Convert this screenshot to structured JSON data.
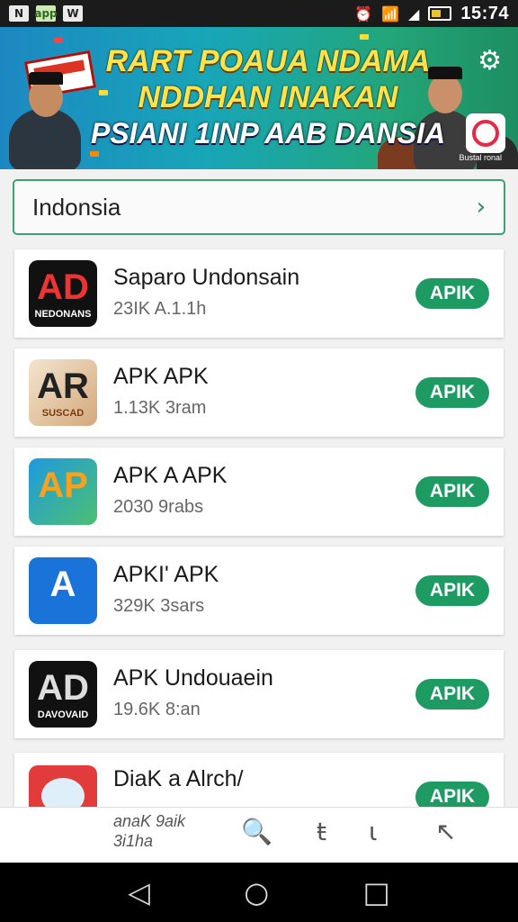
{
  "status_bar": {
    "left_icons": [
      "N",
      "app",
      "W"
    ],
    "time": "15:74",
    "icons": [
      "alarm-icon",
      "wifi-icon",
      "signal-icon",
      "battery-icon"
    ]
  },
  "banner": {
    "line1": "RART POAUA NDAMA",
    "line2": "NDDHAN INAKAN",
    "line3": "PSIANI 1INP AAB DANSIA",
    "small_text": "Bustal ronal",
    "icons": [
      "settings-icon",
      "brand-logo-icon"
    ]
  },
  "country_selector": {
    "label": "Indonsia",
    "chevron": "›"
  },
  "apps": [
    {
      "name": "Saparo Undonsain",
      "meta": "23IK A.1.1h",
      "button": "APIK",
      "icon_glyph": "AD",
      "icon_sub": "NEDONANS"
    },
    {
      "name": "APK APK",
      "meta": "1.13K 3ram",
      "button": "APIK",
      "icon_glyph": "AR",
      "icon_sub": "SUSCAD"
    },
    {
      "name": "APK A APK",
      "meta": "2030 9rabs",
      "button": "APIK",
      "icon_glyph": "AP",
      "icon_sub": ""
    },
    {
      "name": "APKI' APK",
      "meta": "329K 3sars",
      "button": "APIK",
      "icon_glyph": "A",
      "icon_sub": ""
    },
    {
      "name": "APK Undouaein",
      "meta": "19.6K 8:an",
      "button": "APIK",
      "icon_glyph": "AD",
      "icon_sub": "DAVOVAID"
    },
    {
      "name": "DiaK a Alrch/",
      "meta": "",
      "button": "APIK",
      "icon_glyph": "",
      "icon_sub": ""
    }
  ],
  "bottom_nav": {
    "text_line1": "anaK 9aik",
    "text_line2": "3i1ha",
    "items": [
      "search-icon",
      "text-icon",
      "list-icon",
      "back-icon"
    ]
  },
  "colors": {
    "accent": "#1e9a63",
    "status_bar": "#1b1b1b",
    "banner_text": "#ffe34a"
  }
}
